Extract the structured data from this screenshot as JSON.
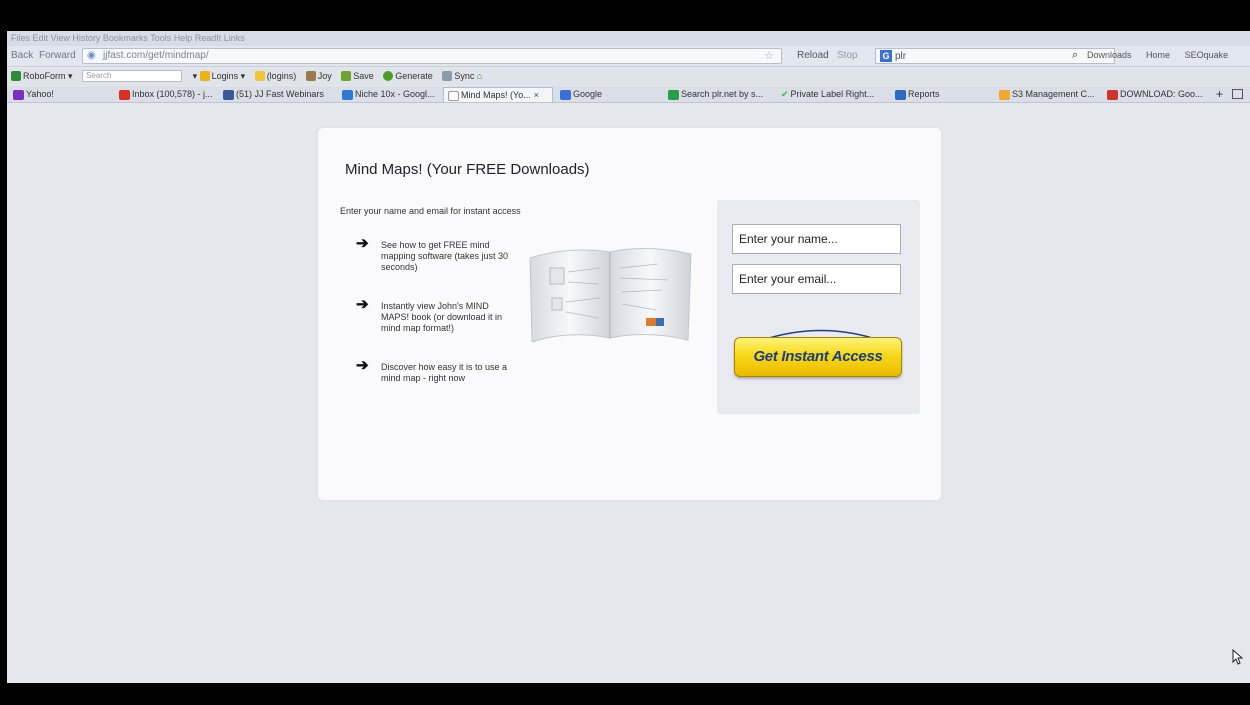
{
  "browser": {
    "menubar": "Files Edit View History Bookmarks Tools Help  ReadIt Links",
    "nav": {
      "back": "Back",
      "forward": "Forward",
      "reload": "Reload",
      "stop": "Stop"
    },
    "url": "jjfast.com/get/mindmap/",
    "search_engine_value": "plr",
    "right_links": [
      "Downloads",
      "Home",
      "SEOquake"
    ]
  },
  "toolbar": {
    "roboform": "RoboForm",
    "search_placeholder": "Search",
    "items": [
      "Logins",
      "(logins)",
      "Joy",
      "Save",
      "Generate",
      "Sync"
    ]
  },
  "tabs": [
    {
      "label": "Yahoo!",
      "icon_color": "#7b2fbf"
    },
    {
      "label": "Inbox (100,578) - j...",
      "icon_color": "#d93025"
    },
    {
      "label": "(51) JJ Fast Webinars",
      "icon_color": "#3b5998"
    },
    {
      "label": "Niche 10x - Googl...",
      "icon_color": "#2b7bd6"
    },
    {
      "label": "Mind Maps! (Yo...",
      "icon_color": "#ffffff",
      "active": true
    },
    {
      "label": "Google",
      "icon_color": "#3b6fd8"
    },
    {
      "label": "Search plr.net by s...",
      "icon_color": "#2a9d49"
    },
    {
      "label": "Private Label Right...",
      "icon_color": "#4caf50"
    },
    {
      "label": "Reports",
      "icon_color": "#2d6cc0"
    },
    {
      "label": "S3 Management C...",
      "icon_color": "#f0a830"
    },
    {
      "label": "DOWNLOAD: Goo...",
      "icon_color": "#d0342c"
    }
  ],
  "page": {
    "title": "Mind Maps! (Your FREE Downloads)",
    "intro": "Enter your name and email for instant access",
    "bullets": [
      "See how to get FREE mind mapping software (takes just 30 seconds)",
      "Instantly view John's MIND MAPS! book (or download it in mind map format!)",
      "Discover how easy it is to use a mind map - right now"
    ],
    "form": {
      "name_placeholder": "Enter your name...",
      "email_placeholder": "Enter your email...",
      "cta": "Get Instant Access"
    }
  }
}
